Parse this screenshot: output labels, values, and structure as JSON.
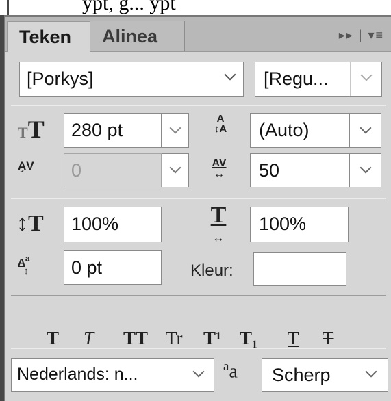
{
  "background_text": "ypt, g... ypt",
  "tabs": [
    {
      "label": "Teken"
    },
    {
      "label": "Alinea"
    }
  ],
  "tab_icons": "▸▸ | ▾≡",
  "font": {
    "family": "[Porkys]",
    "style": "[Regu..."
  },
  "size": {
    "value": "280 pt"
  },
  "leading": {
    "value": "(Auto)"
  },
  "kerning": {
    "value": "0"
  },
  "tracking": {
    "value": "50"
  },
  "vertical_scale": {
    "value": "100%"
  },
  "horizontal_scale": {
    "value": "100%"
  },
  "baseline_shift": {
    "value": "0 pt"
  },
  "color": {
    "label": "Kleur:"
  },
  "style_buttons": [
    "T",
    "T",
    "TT",
    "Tr",
    "T¹",
    "T₁",
    "T",
    "T"
  ],
  "language": {
    "value": "Nederlands: n..."
  },
  "antialias": {
    "icon": "aa",
    "value": "Scherp"
  }
}
